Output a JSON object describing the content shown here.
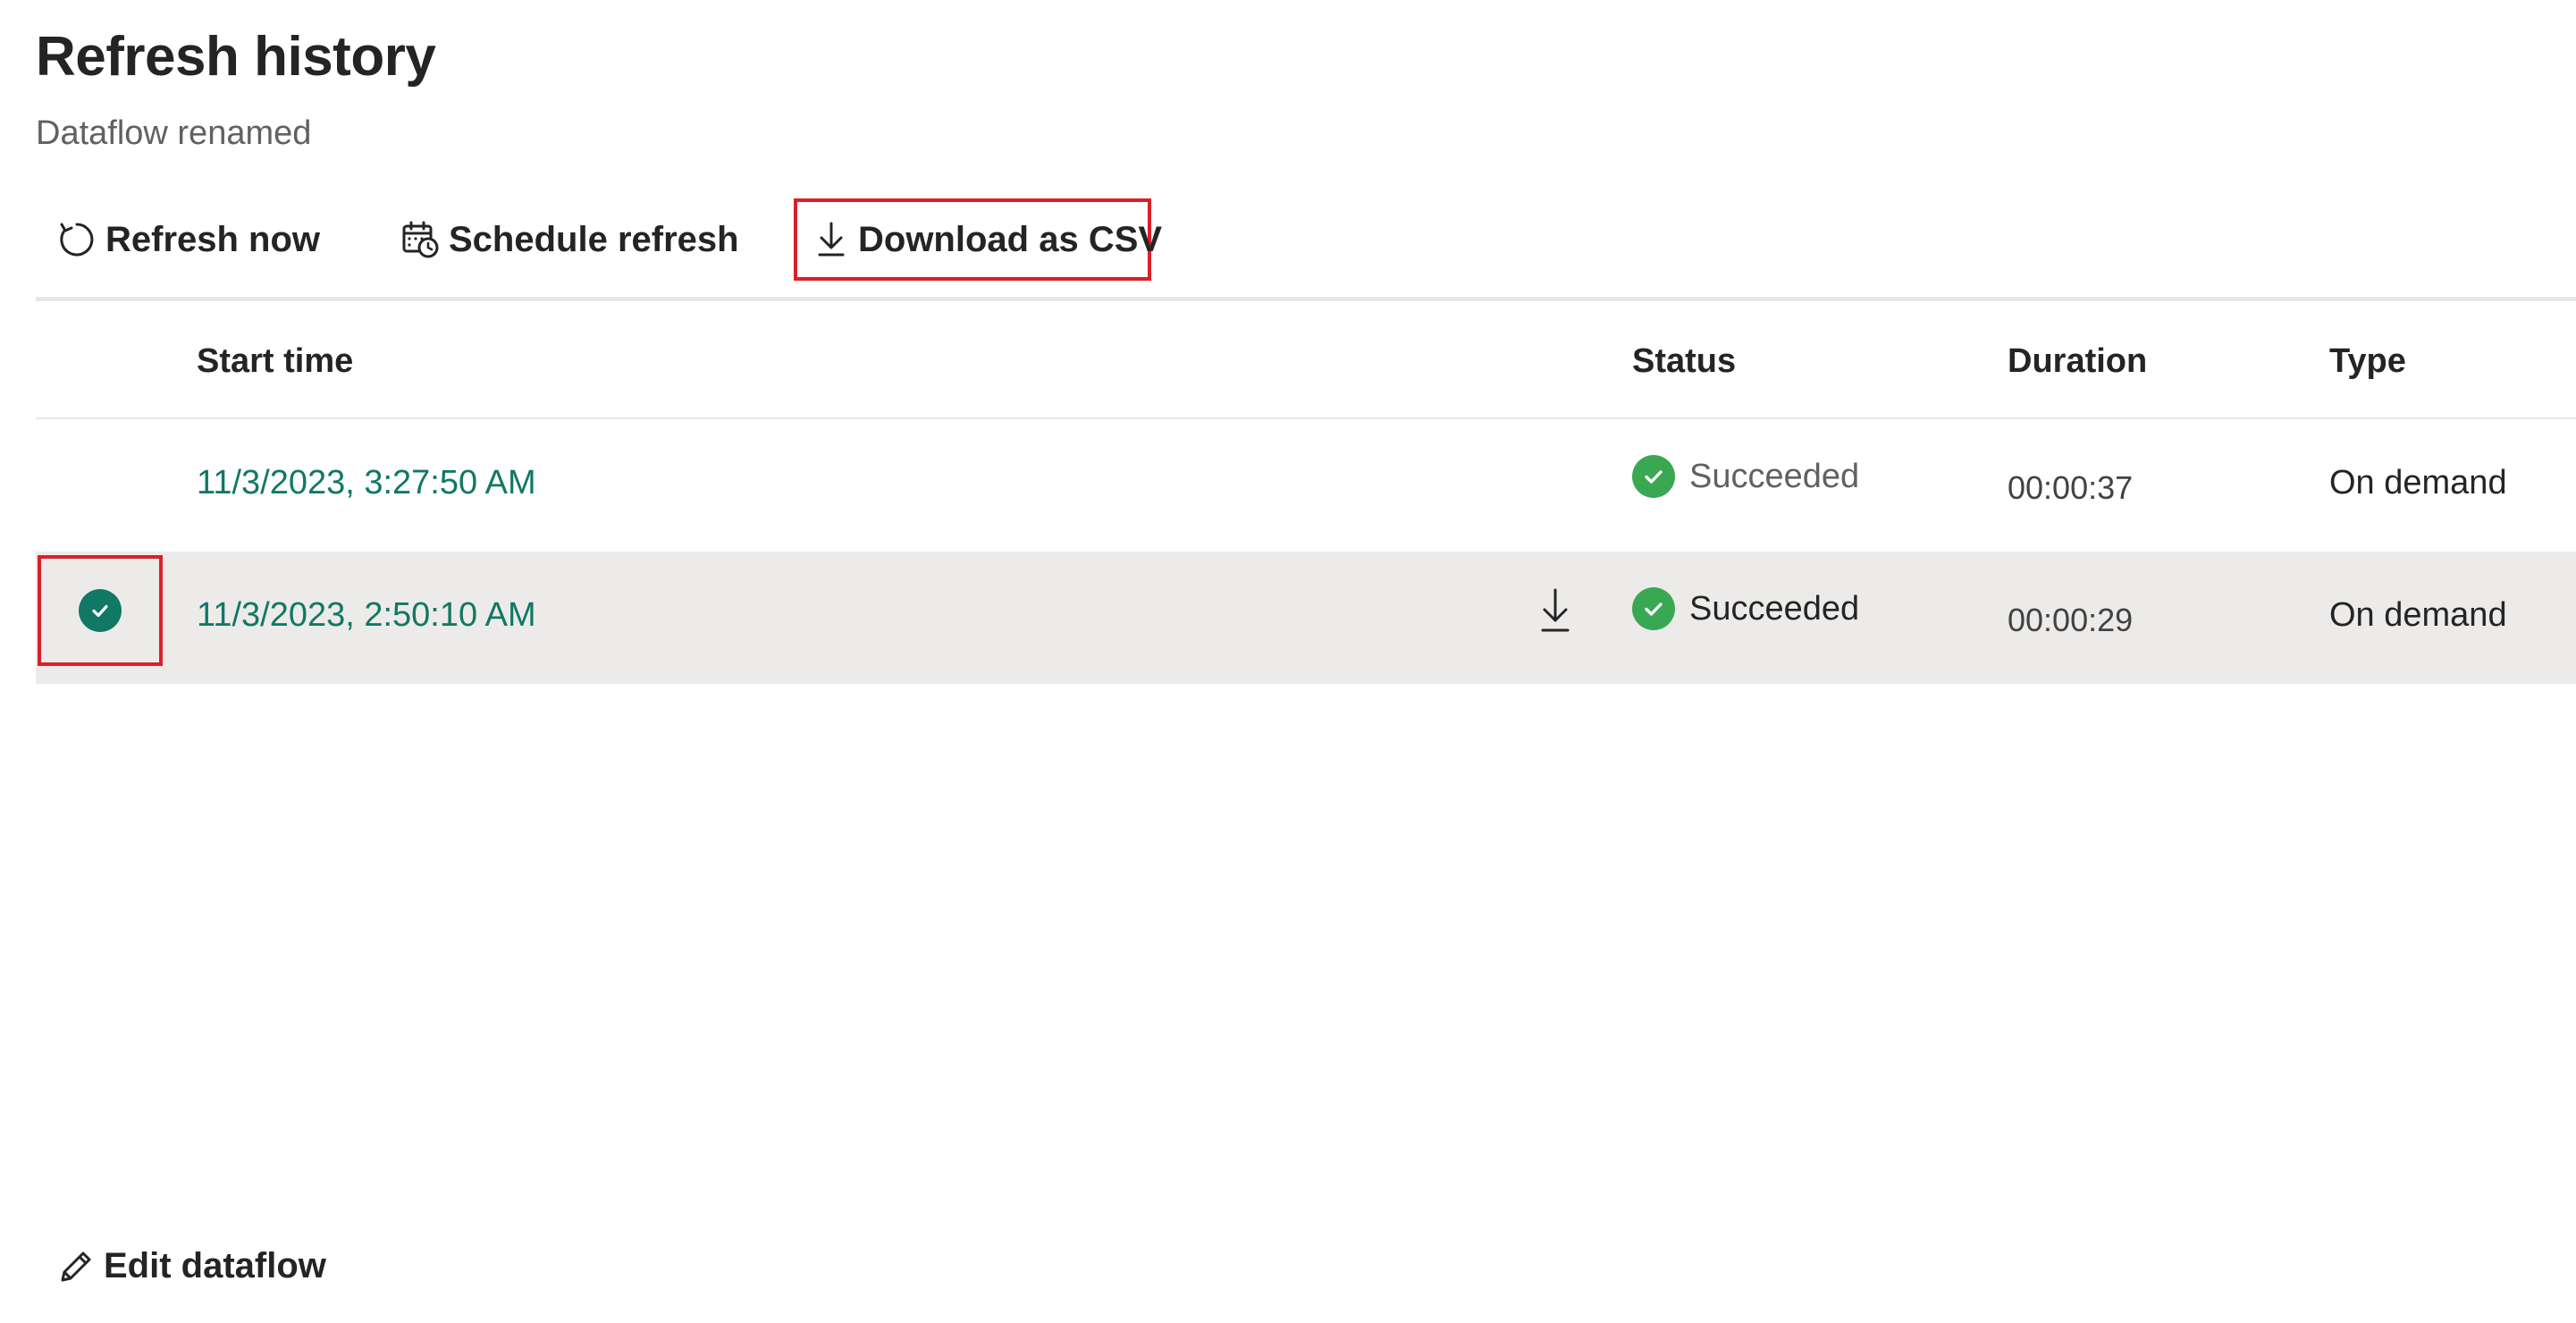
{
  "page": {
    "title": "Refresh history",
    "subtitle": "Dataflow renamed"
  },
  "toolbar": {
    "refresh_label": "Refresh now",
    "schedule_label": "Schedule refresh",
    "download_label": "Download as CSV"
  },
  "table": {
    "headers": {
      "start_time": "Start time",
      "status": "Status",
      "duration": "Duration",
      "type": "Type"
    },
    "rows": [
      {
        "start_time": "11/3/2023, 3:27:50 AM",
        "status": "Succeeded",
        "duration": "00:00:37",
        "type": "On demand",
        "selected": false
      },
      {
        "start_time": "11/3/2023, 2:50:10 AM",
        "status": "Succeeded",
        "duration": "00:00:29",
        "type": "On demand",
        "selected": true
      }
    ]
  },
  "footer": {
    "edit_label": "Edit dataflow"
  },
  "colors": {
    "accent": "#117865",
    "success": "#3aa853",
    "highlight_border": "#d9202a",
    "selected_row": "#edebe9"
  },
  "icons": {
    "refresh": "refresh-icon",
    "schedule": "calendar-clock-icon",
    "download": "download-icon",
    "status": "check-circle-icon",
    "selection": "check-circle-icon",
    "edit": "pencil-icon"
  }
}
